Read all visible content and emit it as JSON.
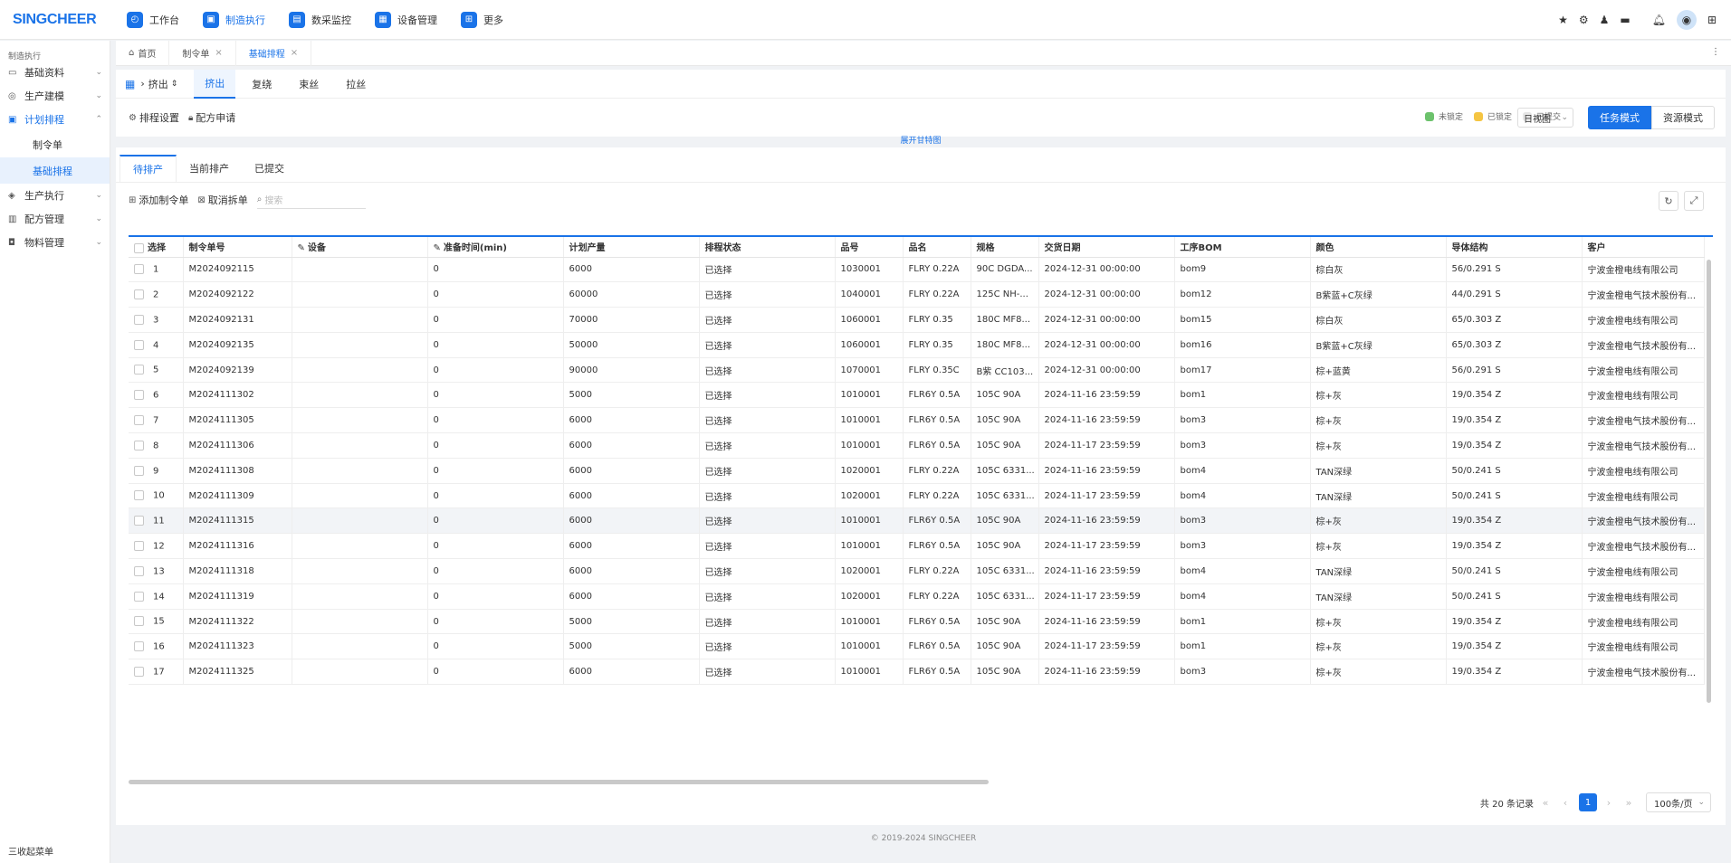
{
  "app": {
    "logo": "SINGCHEER"
  },
  "topnav": [
    {
      "label": "工作台",
      "icon": "dashboard-icon"
    },
    {
      "label": "制造执行",
      "icon": "manufacturing-icon",
      "active": true
    },
    {
      "label": "数采监控",
      "icon": "monitor-icon"
    },
    {
      "label": "设备管理",
      "icon": "equipment-icon"
    },
    {
      "label": "更多",
      "icon": "more-apps-icon"
    }
  ],
  "sidebar": {
    "title": "制造执行",
    "items": [
      {
        "label": "基础资料",
        "icon": "database-icon"
      },
      {
        "label": "生产建模",
        "icon": "model-icon"
      },
      {
        "label": "计划排程",
        "icon": "schedule-icon",
        "open": true,
        "children": [
          {
            "label": "制令单"
          },
          {
            "label": "基础排程",
            "active": true
          }
        ]
      },
      {
        "label": "生产执行",
        "icon": "execute-icon"
      },
      {
        "label": "配方管理",
        "icon": "recipe-icon"
      },
      {
        "label": "物料管理",
        "icon": "material-icon"
      }
    ],
    "footer": "三收起菜单"
  },
  "pagetabs": [
    {
      "label": "首页",
      "icon": "home-icon"
    },
    {
      "label": "制令单",
      "closable": true
    },
    {
      "label": "基础排程",
      "closable": true,
      "active": true
    }
  ],
  "process": {
    "selector": "挤出",
    "tabs": [
      "挤出",
      "复绕",
      "束丝",
      "拉丝"
    ],
    "active": 0
  },
  "toolbar": {
    "schedule_settings": "排程设置",
    "recipe_apply": "配方申请",
    "legend": [
      {
        "label": "未锁定",
        "color": "#6cc26c"
      },
      {
        "label": "已锁定",
        "color": "#f5c542"
      },
      {
        "label": "已提交",
        "color": "#e6e6e6"
      }
    ],
    "view": "日视图",
    "task_mode": "任务模式",
    "resource_mode": "资源模式",
    "gantt_toggle": "展开甘特图"
  },
  "subtabs": [
    "待排产",
    "当前排产",
    "已提交"
  ],
  "actions": {
    "add_order": "添加制令单",
    "cancel_split": "取消拆单",
    "search_placeholder": "搜索"
  },
  "table": {
    "columns": [
      "选择",
      "制令单号",
      "设备",
      "准备时间(min)",
      "计划产量",
      "排程状态",
      "品号",
      "品名",
      "规格",
      "交货日期",
      "工序BOM",
      "颜色",
      "导体结构",
      "客户"
    ],
    "rows": [
      [
        "1",
        "M2024092115",
        "",
        "0",
        "6000",
        "已选择",
        "1030001",
        "FLRY 0.22A",
        "90C DGDA...",
        "2024-12-31 00:00:00",
        "bom9",
        "棕白灰",
        "56/0.291 S",
        "宁波金橙电线有限公司"
      ],
      [
        "2",
        "M2024092122",
        "",
        "0",
        "60000",
        "已选择",
        "1040001",
        "FLRY 0.22A",
        "125C NH-...",
        "2024-12-31 00:00:00",
        "bom12",
        "B紫蓝+C灰绿",
        "44/0.291 S",
        "宁波金橙电气技术股份有..."
      ],
      [
        "3",
        "M2024092131",
        "",
        "0",
        "70000",
        "已选择",
        "1060001",
        "FLRY 0.35",
        "180C MF8...",
        "2024-12-31 00:00:00",
        "bom15",
        "棕白灰",
        "65/0.303 Z",
        "宁波金橙电线有限公司"
      ],
      [
        "4",
        "M2024092135",
        "",
        "0",
        "50000",
        "已选择",
        "1060001",
        "FLRY 0.35",
        "180C MF8...",
        "2024-12-31 00:00:00",
        "bom16",
        "B紫蓝+C灰绿",
        "65/0.303 Z",
        "宁波金橙电气技术股份有..."
      ],
      [
        "5",
        "M2024092139",
        "",
        "0",
        "90000",
        "已选择",
        "1070001",
        "FLRY 0.35C",
        "B紫 CC103...",
        "2024-12-31 00:00:00",
        "bom17",
        "棕+蓝黄",
        "56/0.291 S",
        "宁波金橙电线有限公司"
      ],
      [
        "6",
        "M2024111302",
        "",
        "0",
        "5000",
        "已选择",
        "1010001",
        "FLR6Y 0.5A",
        "105C 90A",
        "2024-11-16 23:59:59",
        "bom1",
        "棕+灰",
        "19/0.354 Z",
        "宁波金橙电线有限公司"
      ],
      [
        "7",
        "M2024111305",
        "",
        "0",
        "6000",
        "已选择",
        "1010001",
        "FLR6Y 0.5A",
        "105C 90A",
        "2024-11-16 23:59:59",
        "bom3",
        "棕+灰",
        "19/0.354 Z",
        "宁波金橙电气技术股份有..."
      ],
      [
        "8",
        "M2024111306",
        "",
        "0",
        "6000",
        "已选择",
        "1010001",
        "FLR6Y 0.5A",
        "105C 90A",
        "2024-11-17 23:59:59",
        "bom3",
        "棕+灰",
        "19/0.354 Z",
        "宁波金橙电气技术股份有..."
      ],
      [
        "9",
        "M2024111308",
        "",
        "0",
        "6000",
        "已选择",
        "1020001",
        "FLRY 0.22A",
        "105C 6331...",
        "2024-11-16 23:59:59",
        "bom4",
        "TAN深绿",
        "50/0.241 S",
        "宁波金橙电线有限公司"
      ],
      [
        "10",
        "M2024111309",
        "",
        "0",
        "6000",
        "已选择",
        "1020001",
        "FLRY 0.22A",
        "105C 6331...",
        "2024-11-17 23:59:59",
        "bom4",
        "TAN深绿",
        "50/0.241 S",
        "宁波金橙电线有限公司"
      ],
      [
        "11",
        "M2024111315",
        "",
        "0",
        "6000",
        "已选择",
        "1010001",
        "FLR6Y 0.5A",
        "105C 90A",
        "2024-11-16 23:59:59",
        "bom3",
        "棕+灰",
        "19/0.354 Z",
        "宁波金橙电气技术股份有..."
      ],
      [
        "12",
        "M2024111316",
        "",
        "0",
        "6000",
        "已选择",
        "1010001",
        "FLR6Y 0.5A",
        "105C 90A",
        "2024-11-17 23:59:59",
        "bom3",
        "棕+灰",
        "19/0.354 Z",
        "宁波金橙电气技术股份有..."
      ],
      [
        "13",
        "M2024111318",
        "",
        "0",
        "6000",
        "已选择",
        "1020001",
        "FLRY 0.22A",
        "105C 6331...",
        "2024-11-16 23:59:59",
        "bom4",
        "TAN深绿",
        "50/0.241 S",
        "宁波金橙电线有限公司"
      ],
      [
        "14",
        "M2024111319",
        "",
        "0",
        "6000",
        "已选择",
        "1020001",
        "FLRY 0.22A",
        "105C 6331...",
        "2024-11-17 23:59:59",
        "bom4",
        "TAN深绿",
        "50/0.241 S",
        "宁波金橙电线有限公司"
      ],
      [
        "15",
        "M2024111322",
        "",
        "0",
        "5000",
        "已选择",
        "1010001",
        "FLR6Y 0.5A",
        "105C 90A",
        "2024-11-16 23:59:59",
        "bom1",
        "棕+灰",
        "19/0.354 Z",
        "宁波金橙电线有限公司"
      ],
      [
        "16",
        "M2024111323",
        "",
        "0",
        "5000",
        "已选择",
        "1010001",
        "FLR6Y 0.5A",
        "105C 90A",
        "2024-11-17 23:59:59",
        "bom1",
        "棕+灰",
        "19/0.354 Z",
        "宁波金橙电线有限公司"
      ],
      [
        "17",
        "M2024111325",
        "",
        "0",
        "6000",
        "已选择",
        "1010001",
        "FLR6Y 0.5A",
        "105C 90A",
        "2024-11-16 23:59:59",
        "bom3",
        "棕+灰",
        "19/0.354 Z",
        "宁波金橙电气技术股份有..."
      ]
    ]
  },
  "pagination": {
    "total": "共 20 条记录",
    "page": "1",
    "page_size": "100条/页"
  },
  "footer": "© 2019-2024 SINGCHEER"
}
